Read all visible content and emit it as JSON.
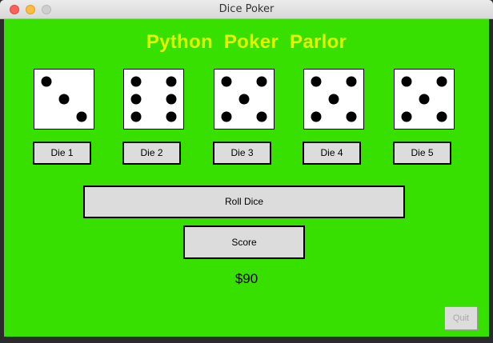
{
  "window": {
    "title": "Dice Poker"
  },
  "app": {
    "heading": "Python  Poker  Parlor",
    "money": "$90",
    "roll_label": "Roll Dice",
    "score_label": "Score",
    "quit_label": "Quit"
  },
  "dice": [
    {
      "value": 3,
      "label": "Die 1"
    },
    {
      "value": 6,
      "label": "Die 2"
    },
    {
      "value": 5,
      "label": "Die 3"
    },
    {
      "value": 5,
      "label": "Die 4"
    },
    {
      "value": 5,
      "label": "Die 5"
    }
  ],
  "colors": {
    "felt": "#38e000",
    "heading": "#e6f200"
  }
}
